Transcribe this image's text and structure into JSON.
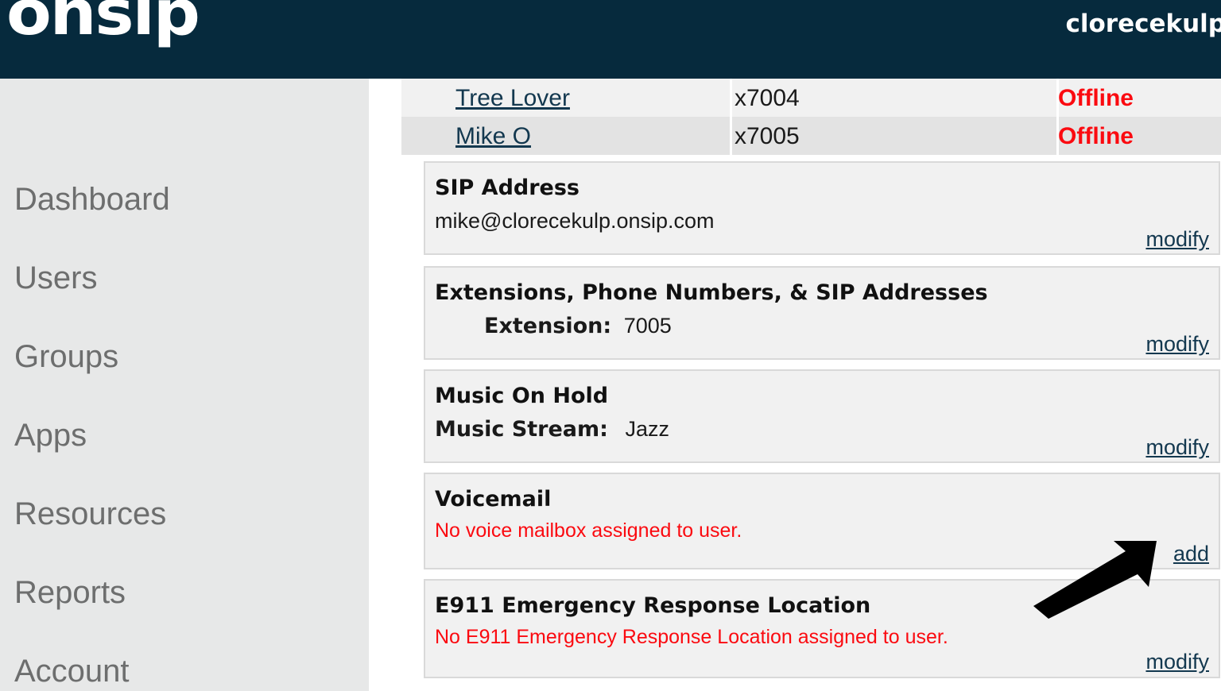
{
  "header": {
    "logo_text": "onsip",
    "account_name": "clorecekulp"
  },
  "sidebar": {
    "items": [
      {
        "label": "Dashboard"
      },
      {
        "label": "Users"
      },
      {
        "label": "Groups"
      },
      {
        "label": "Apps"
      },
      {
        "label": "Resources"
      },
      {
        "label": "Reports"
      },
      {
        "label": "Account"
      }
    ]
  },
  "user_table": {
    "rows": [
      {
        "name": "Tree Lover",
        "extension": "x7004",
        "status": "Offline"
      },
      {
        "name": "Mike O",
        "extension": "x7005",
        "status": "Offline"
      }
    ]
  },
  "panels": {
    "sip_address": {
      "title": "SIP Address",
      "value": "mike@clorecekulp.onsip.com",
      "action": "modify"
    },
    "extensions": {
      "title": "Extensions, Phone Numbers, & SIP Addresses",
      "field_label": "Extension:",
      "field_value": "7005",
      "action": "modify"
    },
    "music_on_hold": {
      "title": "Music On Hold",
      "field_label": "Music Stream:",
      "field_value": "Jazz",
      "action": "modify"
    },
    "voicemail": {
      "title": "Voicemail",
      "alert": "No voice mailbox assigned to user.",
      "action": "add"
    },
    "e911": {
      "title": "E911 Emergency Response Location",
      "alert": "No E911 Emergency Response Location assigned to user.",
      "action": "modify"
    }
  },
  "annotation": {
    "arrow": "arrow-pointing-to-add-link"
  },
  "colors": {
    "header_bg": "#062a3d",
    "sidebar_bg": "#e7e8e8",
    "link": "#13384f",
    "alert": "#fb0a10",
    "panel_bg": "#f1f1f1"
  }
}
